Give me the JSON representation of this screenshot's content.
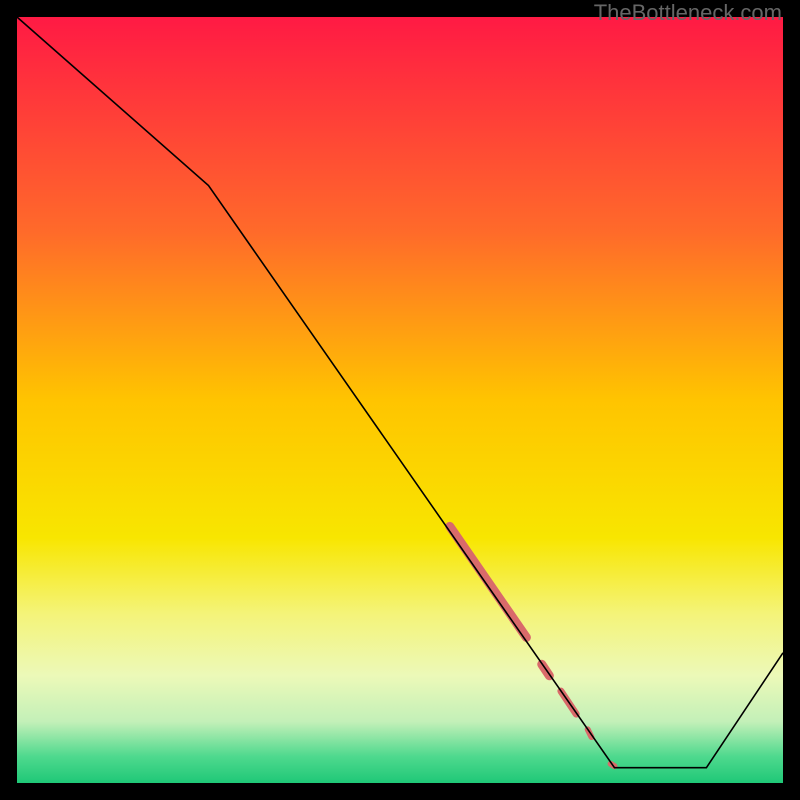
{
  "watermark": "TheBottleneck.com",
  "chart_data": {
    "type": "line",
    "title": "",
    "xlabel": "",
    "ylabel": "",
    "xlim": [
      0,
      100
    ],
    "ylim": [
      0,
      100
    ],
    "gradient_stops": [
      {
        "offset": 0.0,
        "color": "#ff1a44"
      },
      {
        "offset": 0.28,
        "color": "#ff6a2a"
      },
      {
        "offset": 0.5,
        "color": "#ffc400"
      },
      {
        "offset": 0.68,
        "color": "#f8e600"
      },
      {
        "offset": 0.78,
        "color": "#f4f47a"
      },
      {
        "offset": 0.86,
        "color": "#ecf9b8"
      },
      {
        "offset": 0.92,
        "color": "#c3f0b8"
      },
      {
        "offset": 0.965,
        "color": "#4fd98e"
      },
      {
        "offset": 1.0,
        "color": "#1fc877"
      }
    ],
    "curve": {
      "x": [
        0,
        25,
        78,
        90,
        100
      ],
      "y": [
        100,
        78,
        2,
        2,
        17
      ]
    },
    "highlight_band": {
      "color": "#d96a6a",
      "segments": [
        {
          "x0": 56.5,
          "y0": 33.5,
          "x1": 66.5,
          "y1": 19,
          "width": 9
        },
        {
          "x0": 68.5,
          "y0": 15.5,
          "x1": 69.5,
          "y1": 14,
          "width": 9
        },
        {
          "x0": 71.0,
          "y0": 12.0,
          "x1": 73.0,
          "y1": 9.0,
          "width": 7
        },
        {
          "x0": 74.5,
          "y0": 7.0,
          "x1": 75.0,
          "y1": 6.0,
          "width": 6
        },
        {
          "x0": 77.5,
          "y0": 2.5,
          "x1": 78.0,
          "y1": 2.2,
          "width": 6
        }
      ]
    }
  }
}
